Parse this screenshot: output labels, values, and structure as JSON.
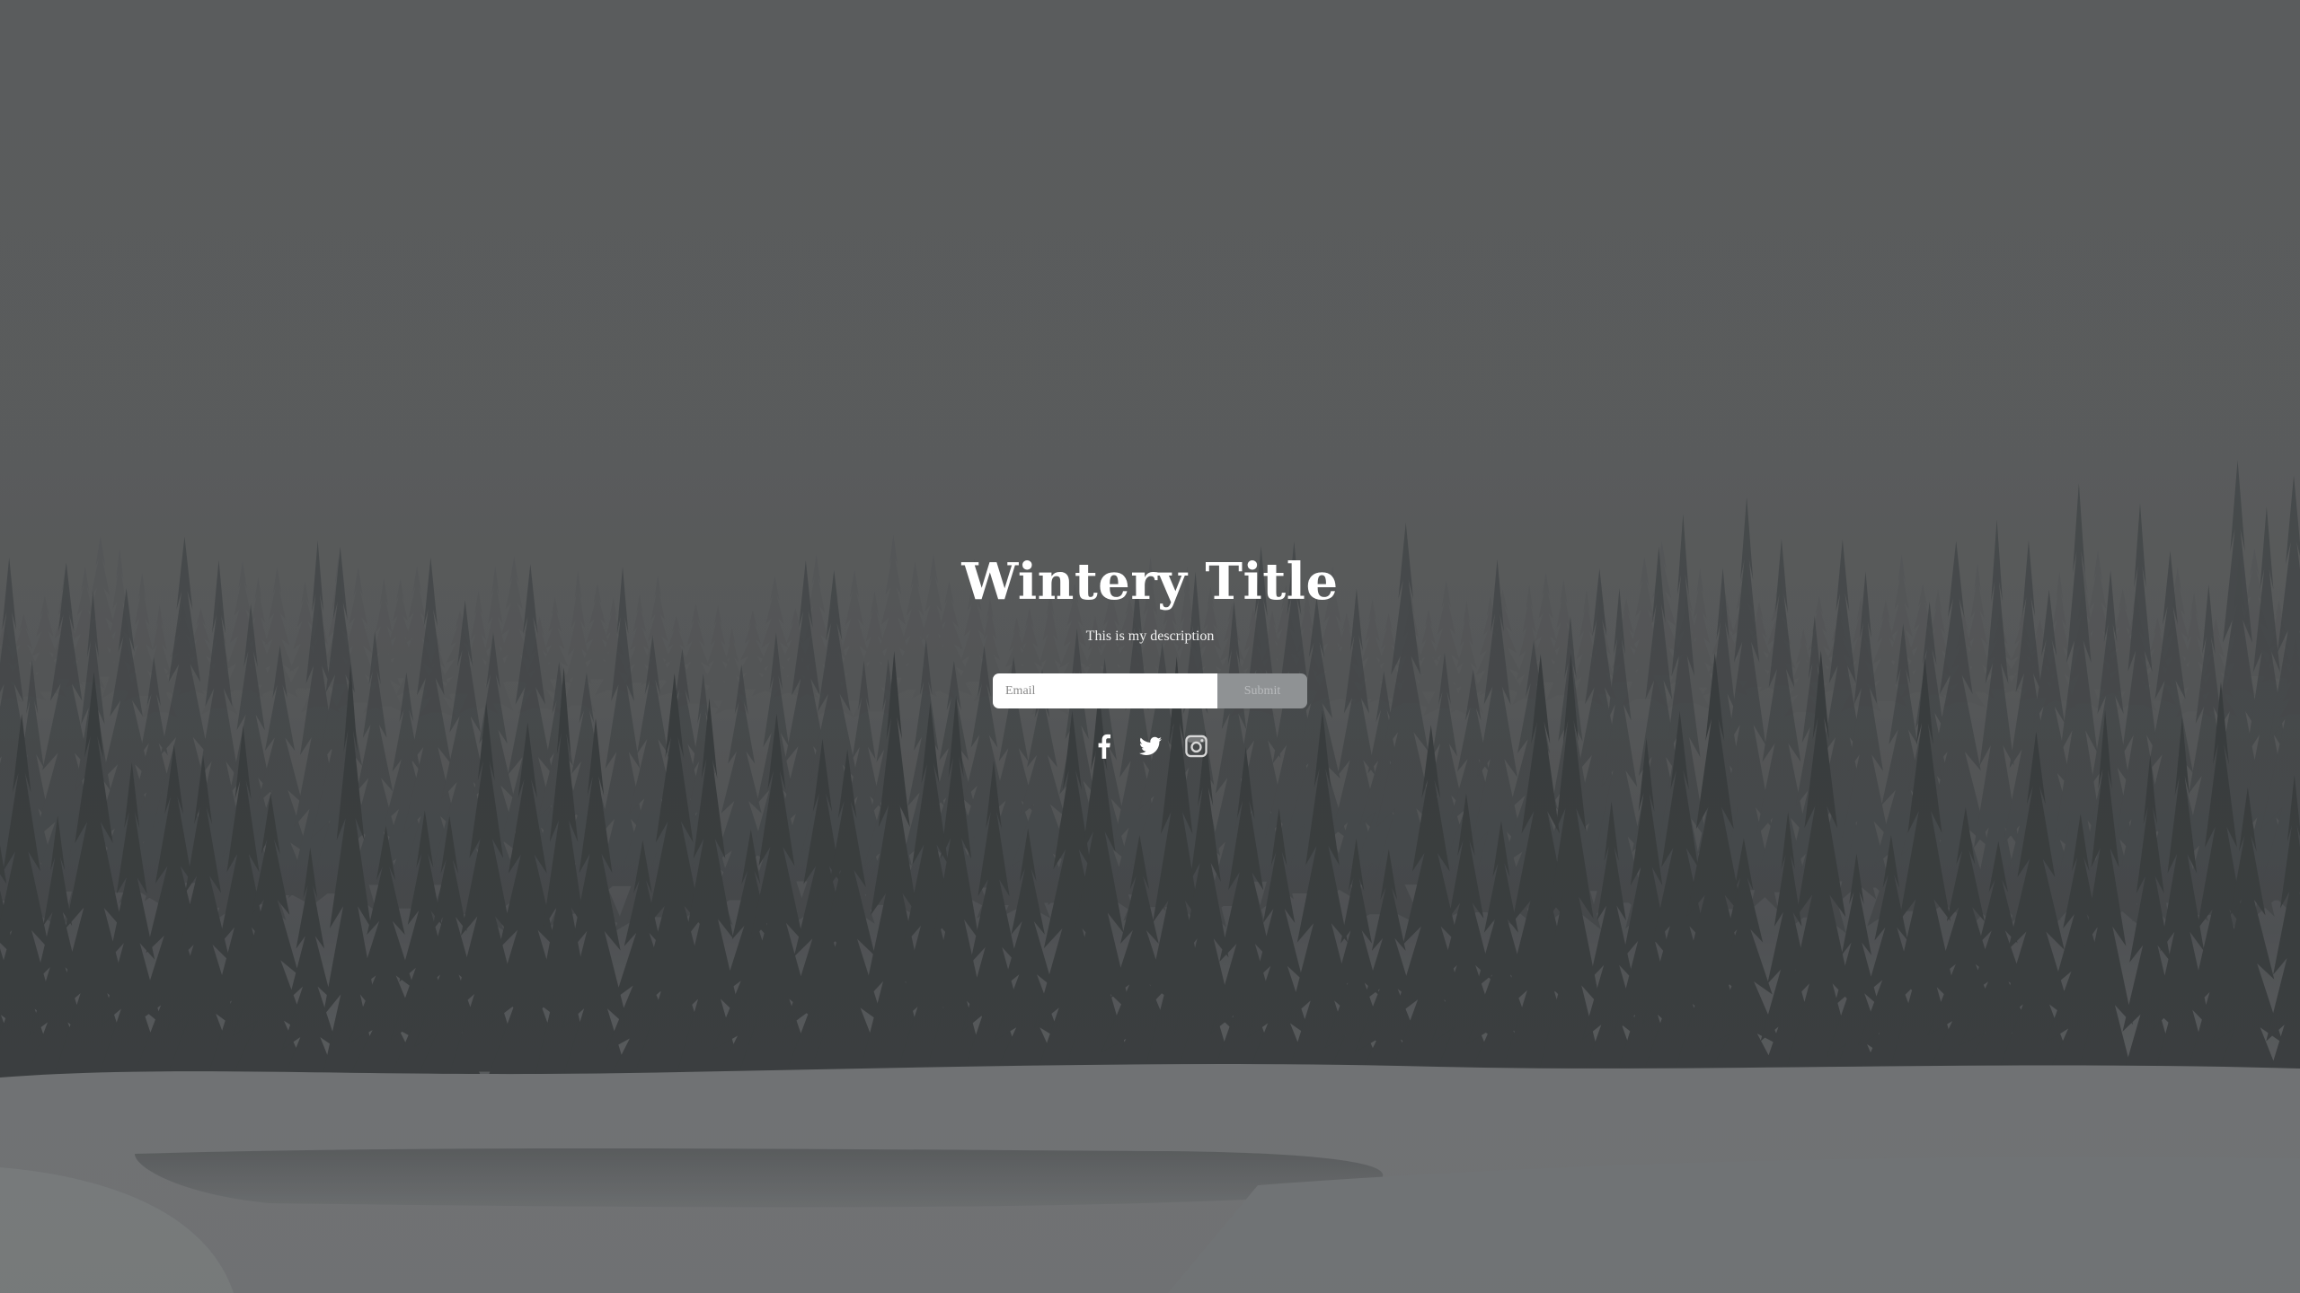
{
  "hero": {
    "title": "Wintery Title",
    "description": "This is my description"
  },
  "signup": {
    "email_placeholder": "Email",
    "submit_label": "Submit"
  },
  "social": [
    {
      "name": "facebook-icon"
    },
    {
      "name": "twitter-icon"
    },
    {
      "name": "instagram-icon"
    }
  ],
  "colors": {
    "sky": "#666768",
    "forest": "#3b3e40",
    "snow": "#8a8c8e",
    "submit_bg": "#8f9294",
    "text": "#ffffff"
  }
}
